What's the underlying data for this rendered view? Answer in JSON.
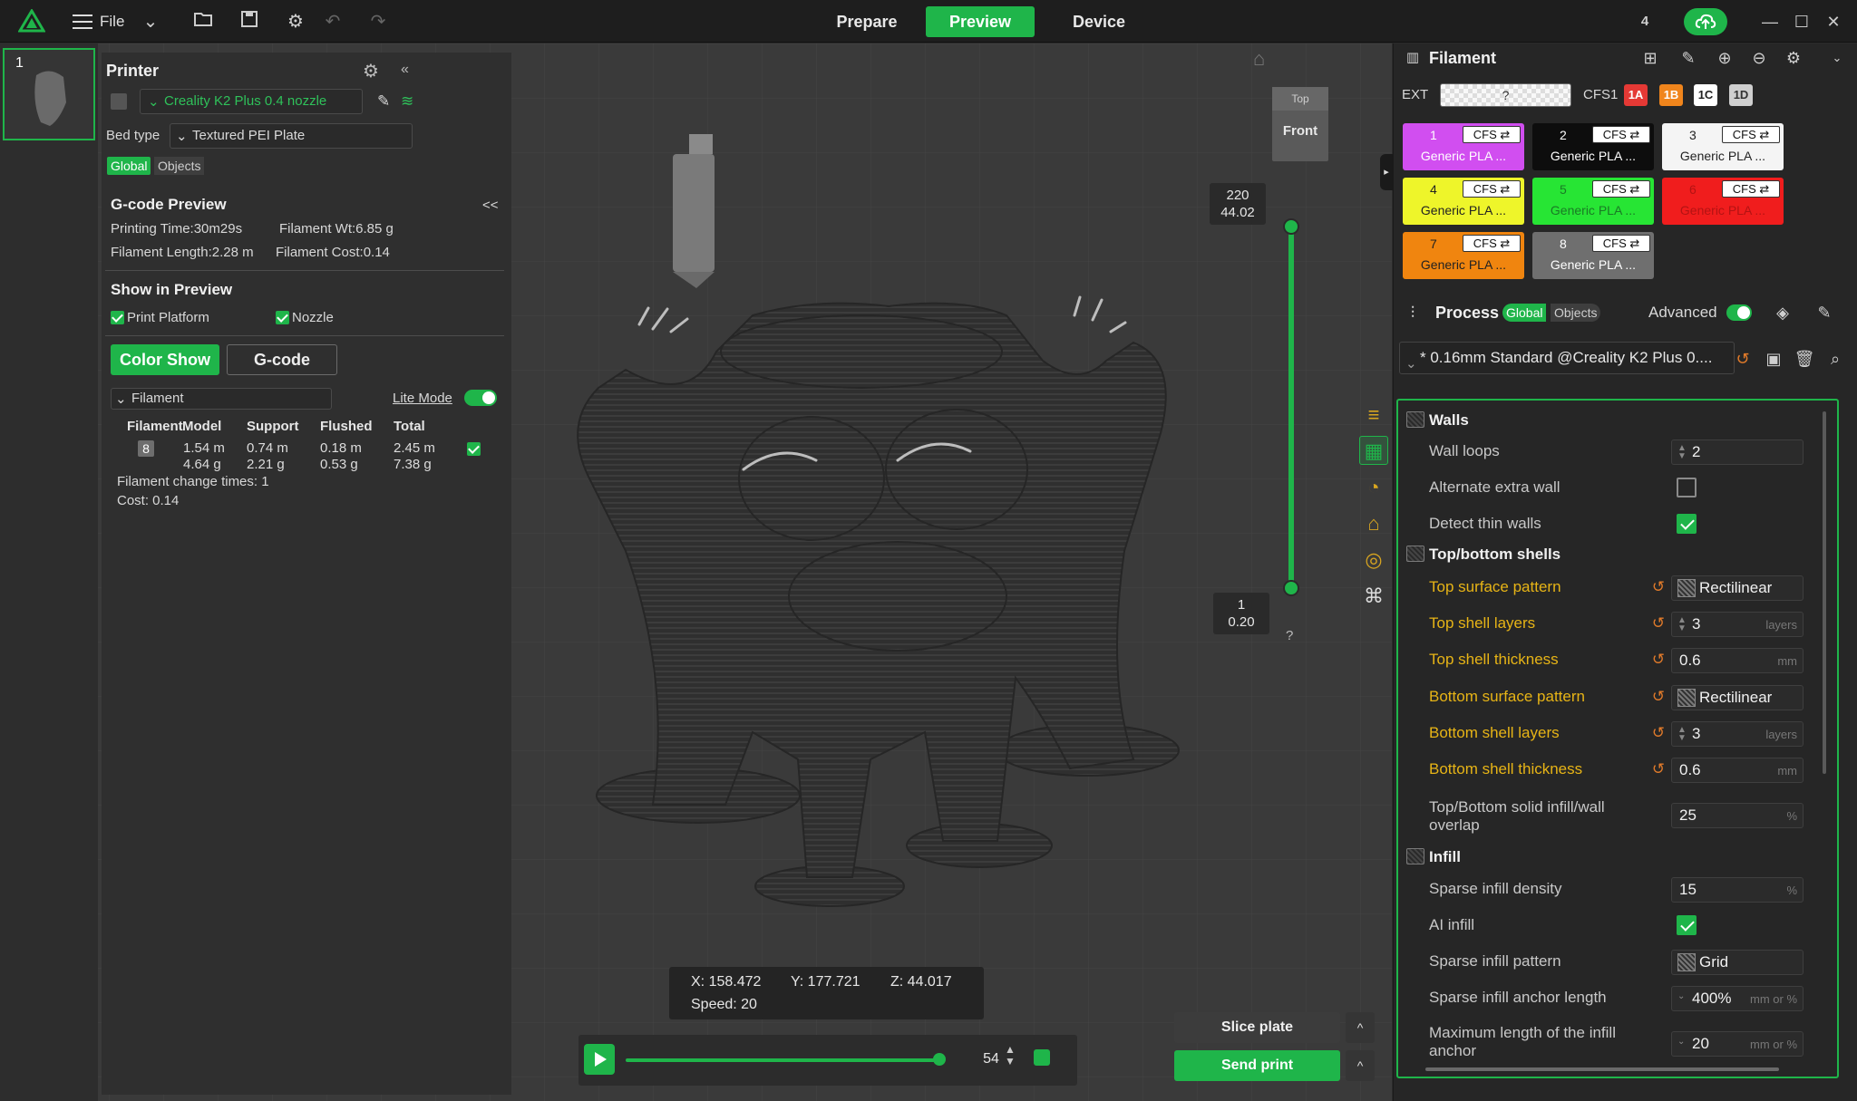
{
  "app": {
    "menu_label": "File",
    "tabs": [
      {
        "label": "Prepare",
        "active": false
      },
      {
        "label": "Preview",
        "active": true
      },
      {
        "label": "Device",
        "active": false
      }
    ],
    "notification_count": "4",
    "accent_color": "#1fb54a"
  },
  "plate": {
    "number": "1"
  },
  "printer": {
    "title": "Printer",
    "name": "Creality K2 Plus 0.4 nozzle",
    "bed_type_label": "Bed type",
    "bed_type_value": "Textured PEI Plate",
    "scope_global": "Global",
    "scope_objects": "Objects"
  },
  "gcode_preview": {
    "title": "G-code Preview",
    "collapse": "<<",
    "printing_time": "Printing Time:30m29s",
    "filament_wt": "Filament Wt:6.85 g",
    "filament_length": "Filament Length:2.28 m",
    "filament_cost": "Filament Cost:0.14",
    "show_title": "Show in Preview",
    "print_platform": "Print Platform",
    "nozzle": "Nozzle",
    "color_show": "Color Show",
    "gcode": "G-code",
    "filament_dropdown": "Filament",
    "lite_mode": "Lite Mode",
    "table": {
      "headers": [
        "Filament",
        "Model",
        "Support",
        "Flushed",
        "Total"
      ],
      "row": {
        "filament": "8",
        "model_m": "1.54 m",
        "model_g": "4.64 g",
        "support_m": "0.74 m",
        "support_g": "2.21 g",
        "flushed_m": "0.18 m",
        "flushed_g": "0.53 g",
        "total_m": "2.45 m",
        "total_g": "7.38 g"
      }
    },
    "change_times": "Filament change times:  1",
    "cost": "Cost:  0.14"
  },
  "viewport": {
    "cube_top": "Top",
    "cube_front": "Front",
    "layer_top": {
      "line1": "220",
      "line2": "44.02"
    },
    "layer_bottom": {
      "line1": "1",
      "line2": "0.20"
    },
    "help": "?",
    "coords": {
      "x": "X: 158.472",
      "y": "Y: 177.721",
      "z": "Z: 44.017",
      "speed": "Speed: 20"
    },
    "step_value": "54",
    "slice_plate": "Slice plate",
    "send_print": "Send print"
  },
  "filament": {
    "title": "Filament",
    "ext_label": "EXT",
    "ext_value": "?",
    "cfs_label": "CFS1",
    "cfs_chips": [
      {
        "label": "1A",
        "bg": "#e53935",
        "fg": "#ffffff"
      },
      {
        "label": "1B",
        "bg": "#f0851c",
        "fg": "#ffffff"
      },
      {
        "label": "1C",
        "bg": "#ffffff",
        "fg": "#222222"
      },
      {
        "label": "1D",
        "bg": "#cfcfcf",
        "fg": "#333333"
      }
    ],
    "slots": [
      {
        "num": "1",
        "tag": "CFS ⇄",
        "name": "Generic PLA ...",
        "bg": "#d14ef0",
        "fg": "#ffffff"
      },
      {
        "num": "2",
        "tag": "CFS ⇄",
        "name": "Generic PLA ...",
        "bg": "#0d0d0d",
        "fg": "#ffffff"
      },
      {
        "num": "3",
        "tag": "CFS ⇄",
        "name": "Generic PLA ...",
        "bg": "#f4f4f4",
        "fg": "#222222"
      },
      {
        "num": "4",
        "tag": "CFS ⇄",
        "name": "Generic PLA ...",
        "bg": "#eef52a",
        "fg": "#222222"
      },
      {
        "num": "5",
        "tag": "CFS ⇄",
        "name": "Generic PLA ...",
        "bg": "#27e534",
        "fg": "#1a7a25"
      },
      {
        "num": "6",
        "tag": "CFS ⇄",
        "name": "Generic PLA ...",
        "bg": "#f01d1d",
        "fg": "#b31313"
      },
      {
        "num": "7",
        "tag": "CFS ⇄",
        "name": "Generic PLA ...",
        "bg": "#f0850f",
        "fg": "#222222"
      },
      {
        "num": "8",
        "tag": "CFS ⇄",
        "name": "Generic PLA ...",
        "bg": "#6f6f6f",
        "fg": "#ffffff"
      }
    ]
  },
  "process": {
    "title": "Process",
    "scope_global": "Global",
    "scope_objects": "Objects",
    "advanced": "Advanced",
    "preset": "* 0.16mm Standard @Creality K2 Plus 0...."
  },
  "settings": {
    "walls": {
      "title": "Walls",
      "wall_loops": {
        "label": "Wall loops",
        "value": "2"
      },
      "alternate_extra_wall": {
        "label": "Alternate extra wall",
        "checked": false
      },
      "detect_thin_walls": {
        "label": "Detect thin walls",
        "checked": true
      }
    },
    "shells": {
      "title": "Top/bottom shells",
      "top_surface_pattern": {
        "label": "Top surface pattern",
        "value": "Rectilinear"
      },
      "top_shell_layers": {
        "label": "Top shell layers",
        "value": "3",
        "unit": "layers"
      },
      "top_shell_thickness": {
        "label": "Top shell thickness",
        "value": "0.6",
        "unit": "mm"
      },
      "bottom_surface_pattern": {
        "label": "Bottom surface pattern",
        "value": "Rectilinear"
      },
      "bottom_shell_layers": {
        "label": "Bottom shell layers",
        "value": "3",
        "unit": "layers"
      },
      "bottom_shell_thickness": {
        "label": "Bottom shell thickness",
        "value": "0.6",
        "unit": "mm"
      },
      "overlap": {
        "label": "Top/Bottom solid infill/wall overlap",
        "value": "25",
        "unit": "%"
      }
    },
    "infill": {
      "title": "Infill",
      "density": {
        "label": "Sparse infill density",
        "value": "15",
        "unit": "%"
      },
      "ai_infill": {
        "label": "AI infill",
        "checked": true
      },
      "pattern": {
        "label": "Sparse infill pattern",
        "value": "Grid"
      },
      "anchor_length": {
        "label": "Sparse infill anchor length",
        "value": "400%",
        "unit": "mm or %"
      },
      "max_anchor": {
        "label": "Maximum length of the infill anchor",
        "value": "20",
        "unit": "mm or %"
      }
    }
  }
}
